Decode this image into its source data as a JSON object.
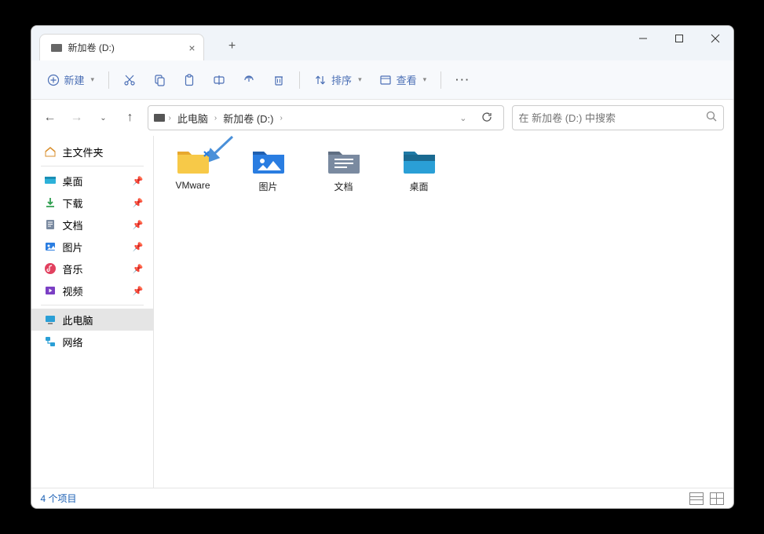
{
  "tab": {
    "title": "新加卷 (D:)"
  },
  "toolbar": {
    "new_label": "新建",
    "sort_label": "排序",
    "view_label": "查看"
  },
  "breadcrumb": {
    "seg1": "此电脑",
    "seg2": "新加卷 (D:)"
  },
  "search": {
    "placeholder": "在 新加卷 (D:) 中搜索"
  },
  "sidebar": {
    "home": "主文件夹",
    "desktop": "桌面",
    "downloads": "下载",
    "documents": "文档",
    "pictures": "图片",
    "music": "音乐",
    "videos": "视频",
    "thispc": "此电脑",
    "network": "网络"
  },
  "items": [
    {
      "label": "VMware"
    },
    {
      "label": "图片"
    },
    {
      "label": "文档"
    },
    {
      "label": "桌面"
    }
  ],
  "status": {
    "text": "4 个项目"
  }
}
